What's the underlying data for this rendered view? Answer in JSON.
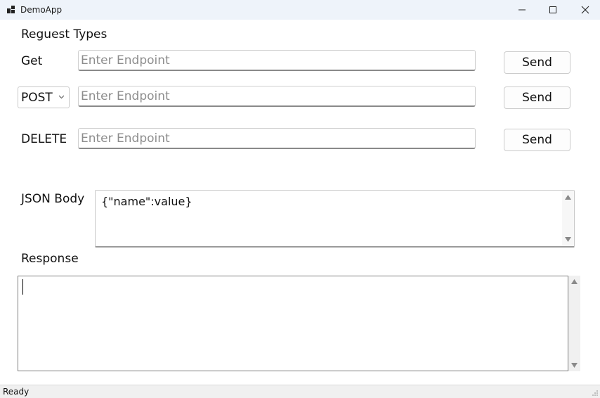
{
  "window": {
    "title": "DemoApp"
  },
  "header": {
    "request_types_label": "Reguest Types"
  },
  "rows": {
    "get": {
      "method_label": "Get",
      "endpoint_placeholder": "Enter Endpoint",
      "endpoint_value": "",
      "send_label": "Send"
    },
    "post": {
      "method_selected": "POST",
      "endpoint_placeholder": "Enter Endpoint",
      "endpoint_value": "",
      "send_label": "Send"
    },
    "delete": {
      "method_label": "DELETE",
      "endpoint_placeholder": "Enter Endpoint",
      "endpoint_value": "",
      "send_label": "Send"
    }
  },
  "json_body": {
    "label": "JSON Body",
    "value": "{\"name\":value}"
  },
  "response": {
    "label": "Response",
    "value": ""
  },
  "status": {
    "text": "Ready"
  },
  "icons": {
    "app": "app-icon",
    "minimize": "minimize-icon",
    "maximize": "maximize-icon",
    "close": "close-icon",
    "dropdown": "chevron-down-icon",
    "scroll_up": "scroll-up-arrow-icon",
    "scroll_down": "scroll-down-arrow-icon",
    "grip": "resize-grip-icon"
  },
  "colors": {
    "titlebar_bg": "#eef3fa",
    "statusbar_bg": "#f0f0f0",
    "field_border": "#8a8a8a",
    "placeholder": "#8d8d8d"
  }
}
